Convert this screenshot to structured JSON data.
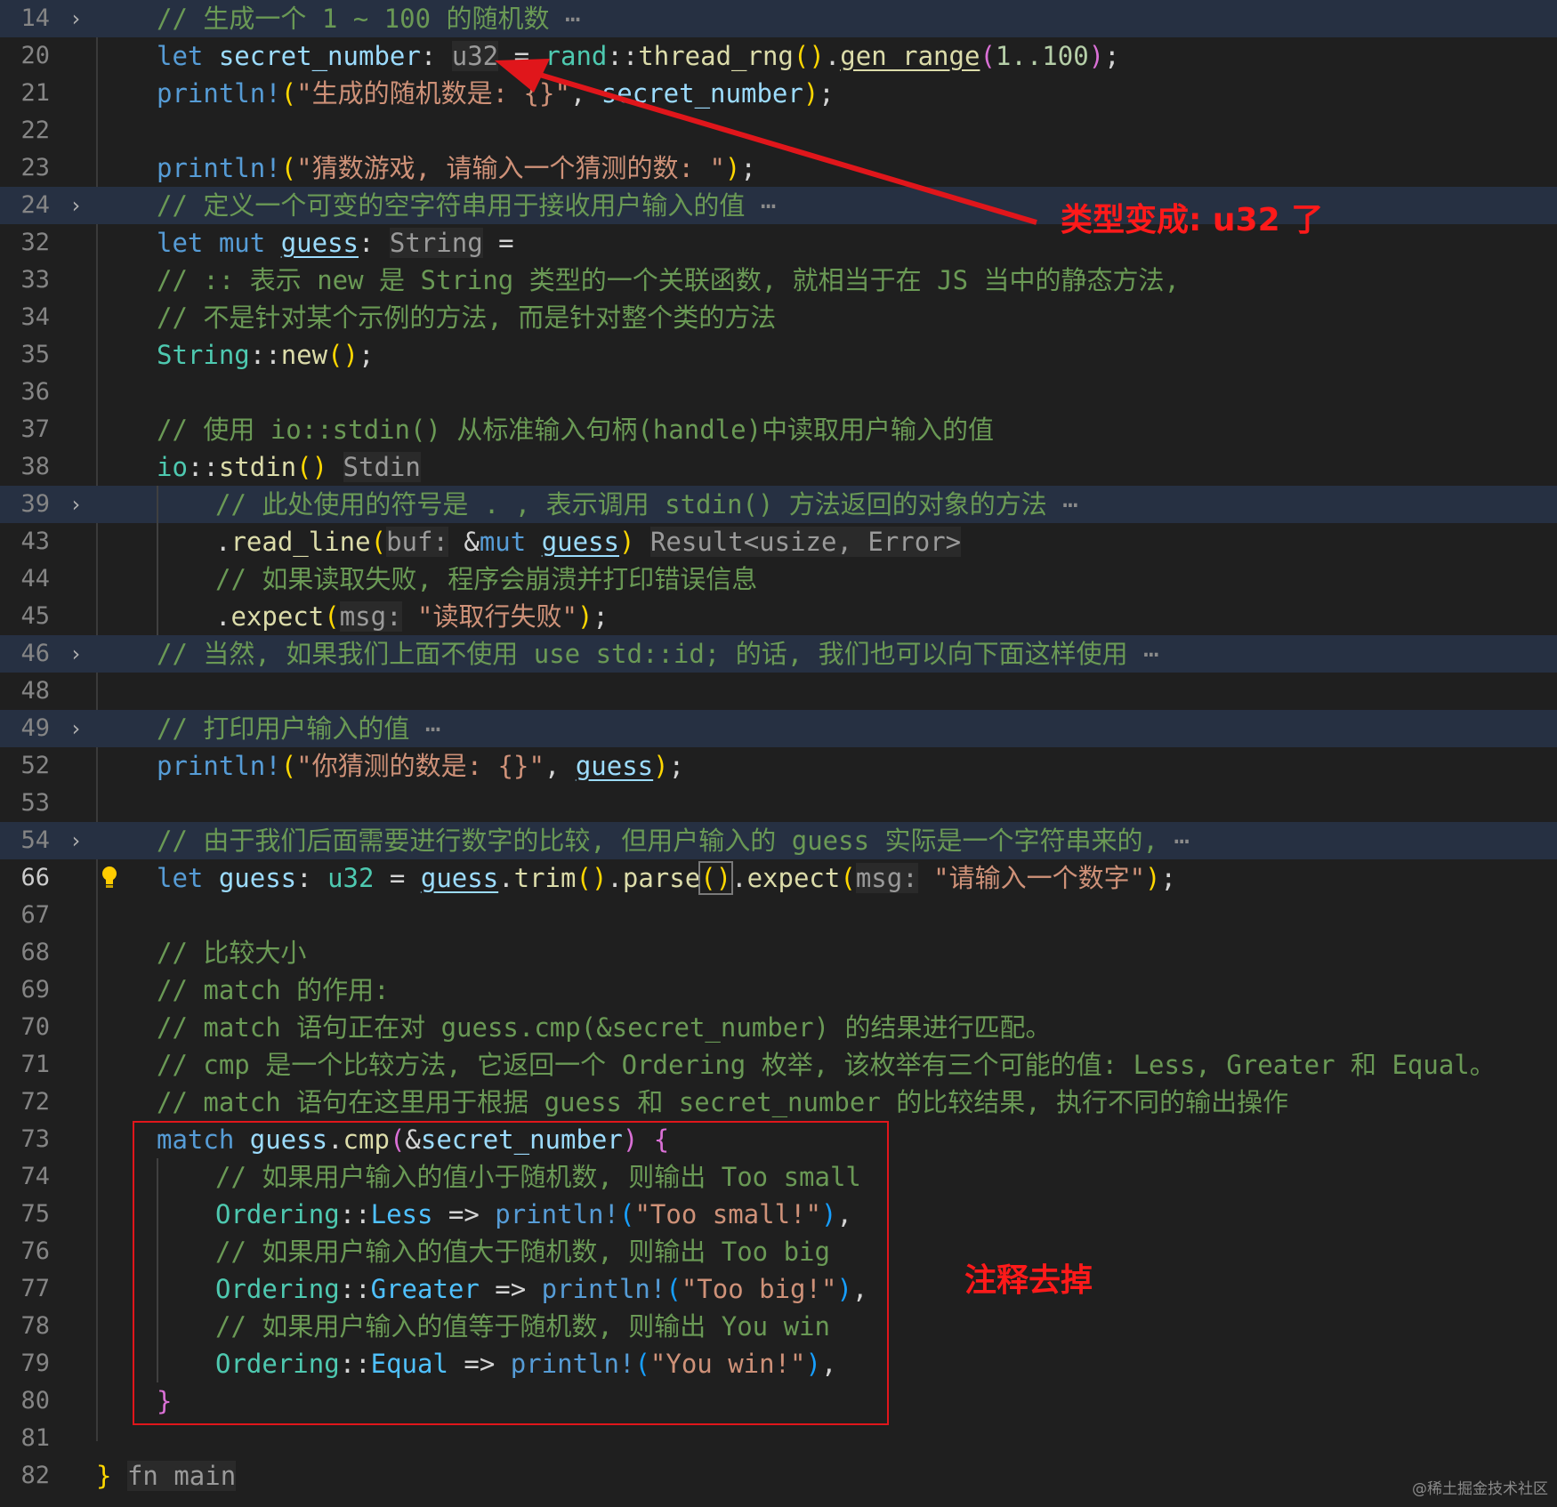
{
  "lines": [
    {
      "num": "14",
      "folded": true,
      "text": "// 生成一个 1 ~ 100 的随机数"
    },
    {
      "num": "20",
      "pre": "let ",
      "name": "secret_number",
      "colon": ": ",
      "hint": "u32",
      "eq": " = ",
      "p1": "rand",
      "p2": "::",
      "p3": "thread_rng",
      "p4": "()",
      "p5": ".",
      "p6": "gen_range",
      "p7": "(",
      "p8": "1..100",
      "p9": ")",
      "p10": ";"
    },
    {
      "num": "21",
      "mac": "println!",
      "lp": "(",
      "str": "\"生成的随机数是: {}\"",
      "sep": ", ",
      "arg": "secret_number",
      "rp": ")",
      "end": ";"
    },
    {
      "num": "22"
    },
    {
      "num": "23",
      "mac": "println!",
      "lp": "(",
      "str": "\"猜数游戏, 请输入一个猜测的数: \"",
      "rp": ")",
      "end": ";"
    },
    {
      "num": "24",
      "folded": true,
      "text": "// 定义一个可变的空字符串用于接收用户输入的值"
    },
    {
      "num": "32",
      "pre": "let mut ",
      "name": "guess",
      "colon": ": ",
      "hint": "String",
      "eq": " ="
    },
    {
      "num": "33",
      "text": "// :: 表示 new 是 String 类型的一个关联函数, 就相当于在 JS 当中的静态方法,"
    },
    {
      "num": "34",
      "text": "// 不是针对某个示例的方法, 而是针对整个类的方法"
    },
    {
      "num": "35",
      "ty": "String",
      "sep": "::",
      "fn": "new",
      "par": "()",
      "end": ";"
    },
    {
      "num": "36"
    },
    {
      "num": "37",
      "text": "// 使用 io::stdin() 从标准输入句柄(handle)中读取用户输入的值"
    },
    {
      "num": "38",
      "mod": "io",
      "sep": "::",
      "fn": "stdin",
      "par": "()",
      "hint": "Stdin"
    },
    {
      "num": "39",
      "folded": true,
      "text": "// 此处使用的符号是 . , 表示调用 stdin() 方法返回的对象的方法"
    },
    {
      "num": "43",
      "dot": ".",
      "fn": "read_line",
      "lp": "(",
      "lbl": "buf:",
      "amp": " &",
      "mut": "mut",
      "sp": " ",
      "arg": "guess",
      "rp": ")",
      "hint": "Result<usize, Error>"
    },
    {
      "num": "44",
      "text": "// 如果读取失败, 程序会崩溃并打印错误信息"
    },
    {
      "num": "45",
      "dot": ".",
      "fn": "expect",
      "lp": "(",
      "lbl": "msg:",
      "str": " \"读取行失败\"",
      "rp": ")",
      "end": ";"
    },
    {
      "num": "46",
      "folded": true,
      "text": "// 当然, 如果我们上面不使用 use std::id; 的话, 我们也可以向下面这样使用"
    },
    {
      "num": "48"
    },
    {
      "num": "49",
      "folded": true,
      "text": "// 打印用户输入的值"
    },
    {
      "num": "52",
      "mac": "println!",
      "lp": "(",
      "str": "\"你猜测的数是: {}\"",
      "sep": ", ",
      "arg": "guess",
      "rp": ")",
      "end": ";"
    },
    {
      "num": "53"
    },
    {
      "num": "54",
      "folded": true,
      "text": "// 由于我们后面需要进行数字的比较, 但用户输入的 guess 实际是一个字符串来的,"
    },
    {
      "num": "66",
      "active": true,
      "kw": "let ",
      "name": "guess",
      "colon": ": ",
      "ty": "u32",
      "eq": " = ",
      "arg": "guess",
      "d1": ".",
      "f1": "trim",
      "pa": "()",
      "d2": ".",
      "f2": "parse",
      "pb": "()",
      "d3": ".",
      "f3": "expect",
      "lp": "(",
      "lbl": "msg:",
      "str": " \"请输入一个数字\"",
      "rp": ")",
      "end": ";"
    },
    {
      "num": "67"
    },
    {
      "num": "68",
      "text": "// 比较大小"
    },
    {
      "num": "69",
      "text": "// match 的作用:"
    },
    {
      "num": "70",
      "text": "// match 语句正在对 guess.cmp(&secret_number) 的结果进行匹配。"
    },
    {
      "num": "71",
      "text": "// cmp 是一个比较方法, 它返回一个 Ordering 枚举, 该枚举有三个可能的值: Less, Greater 和 Equal。"
    },
    {
      "num": "72",
      "text": "// match 语句在这里用于根据 guess 和 secret_number 的比较结果, 执行不同的输出操作"
    },
    {
      "num": "73",
      "kw": "match ",
      "arg": "guess",
      "dot": ".",
      "fn": "cmp",
      "lp": "(",
      "amp": "&",
      "arg2": "secret_number",
      "rp": ")",
      "br": " {"
    },
    {
      "num": "74",
      "text": "// 如果用户输入的值小于随机数, 则输出 Too small"
    },
    {
      "num": "75",
      "ty": "Ordering",
      "sep": "::",
      "en": "Less",
      "arr": " => ",
      "mac": "println!",
      "lp": "(",
      "str": "\"Too small!\"",
      "rp": ")",
      "end": ","
    },
    {
      "num": "76",
      "text": "// 如果用户输入的值大于随机数, 则输出 Too big"
    },
    {
      "num": "77",
      "ty": "Ordering",
      "sep": "::",
      "en": "Greater",
      "arr": " => ",
      "mac": "println!",
      "lp": "(",
      "str": "\"Too big!\"",
      "rp": ")",
      "end": ","
    },
    {
      "num": "78",
      "text": "// 如果用户输入的值等于随机数, 则输出 You win"
    },
    {
      "num": "79",
      "ty": "Ordering",
      "sep": "::",
      "en": "Equal",
      "arr": " => ",
      "mac": "println!",
      "lp": "(",
      "str": "\"You win!\"",
      "rp": ")",
      "end": ","
    },
    {
      "num": "80",
      "br": "}"
    },
    {
      "num": "81"
    },
    {
      "num": "82",
      "br": "}",
      "hint": "fn main"
    }
  ],
  "fold_dots": "⋯",
  "annotations": {
    "type_changed": "类型变成: u32 了",
    "remove_comments": "注释去掉"
  },
  "watermark": "@稀土掘金技术社区",
  "icons": {
    "fold": "chevron-right-icon",
    "bulb": "lightbulb-icon"
  },
  "colors": {
    "annotation": "#e0161b",
    "background": "#1f1f1f"
  }
}
